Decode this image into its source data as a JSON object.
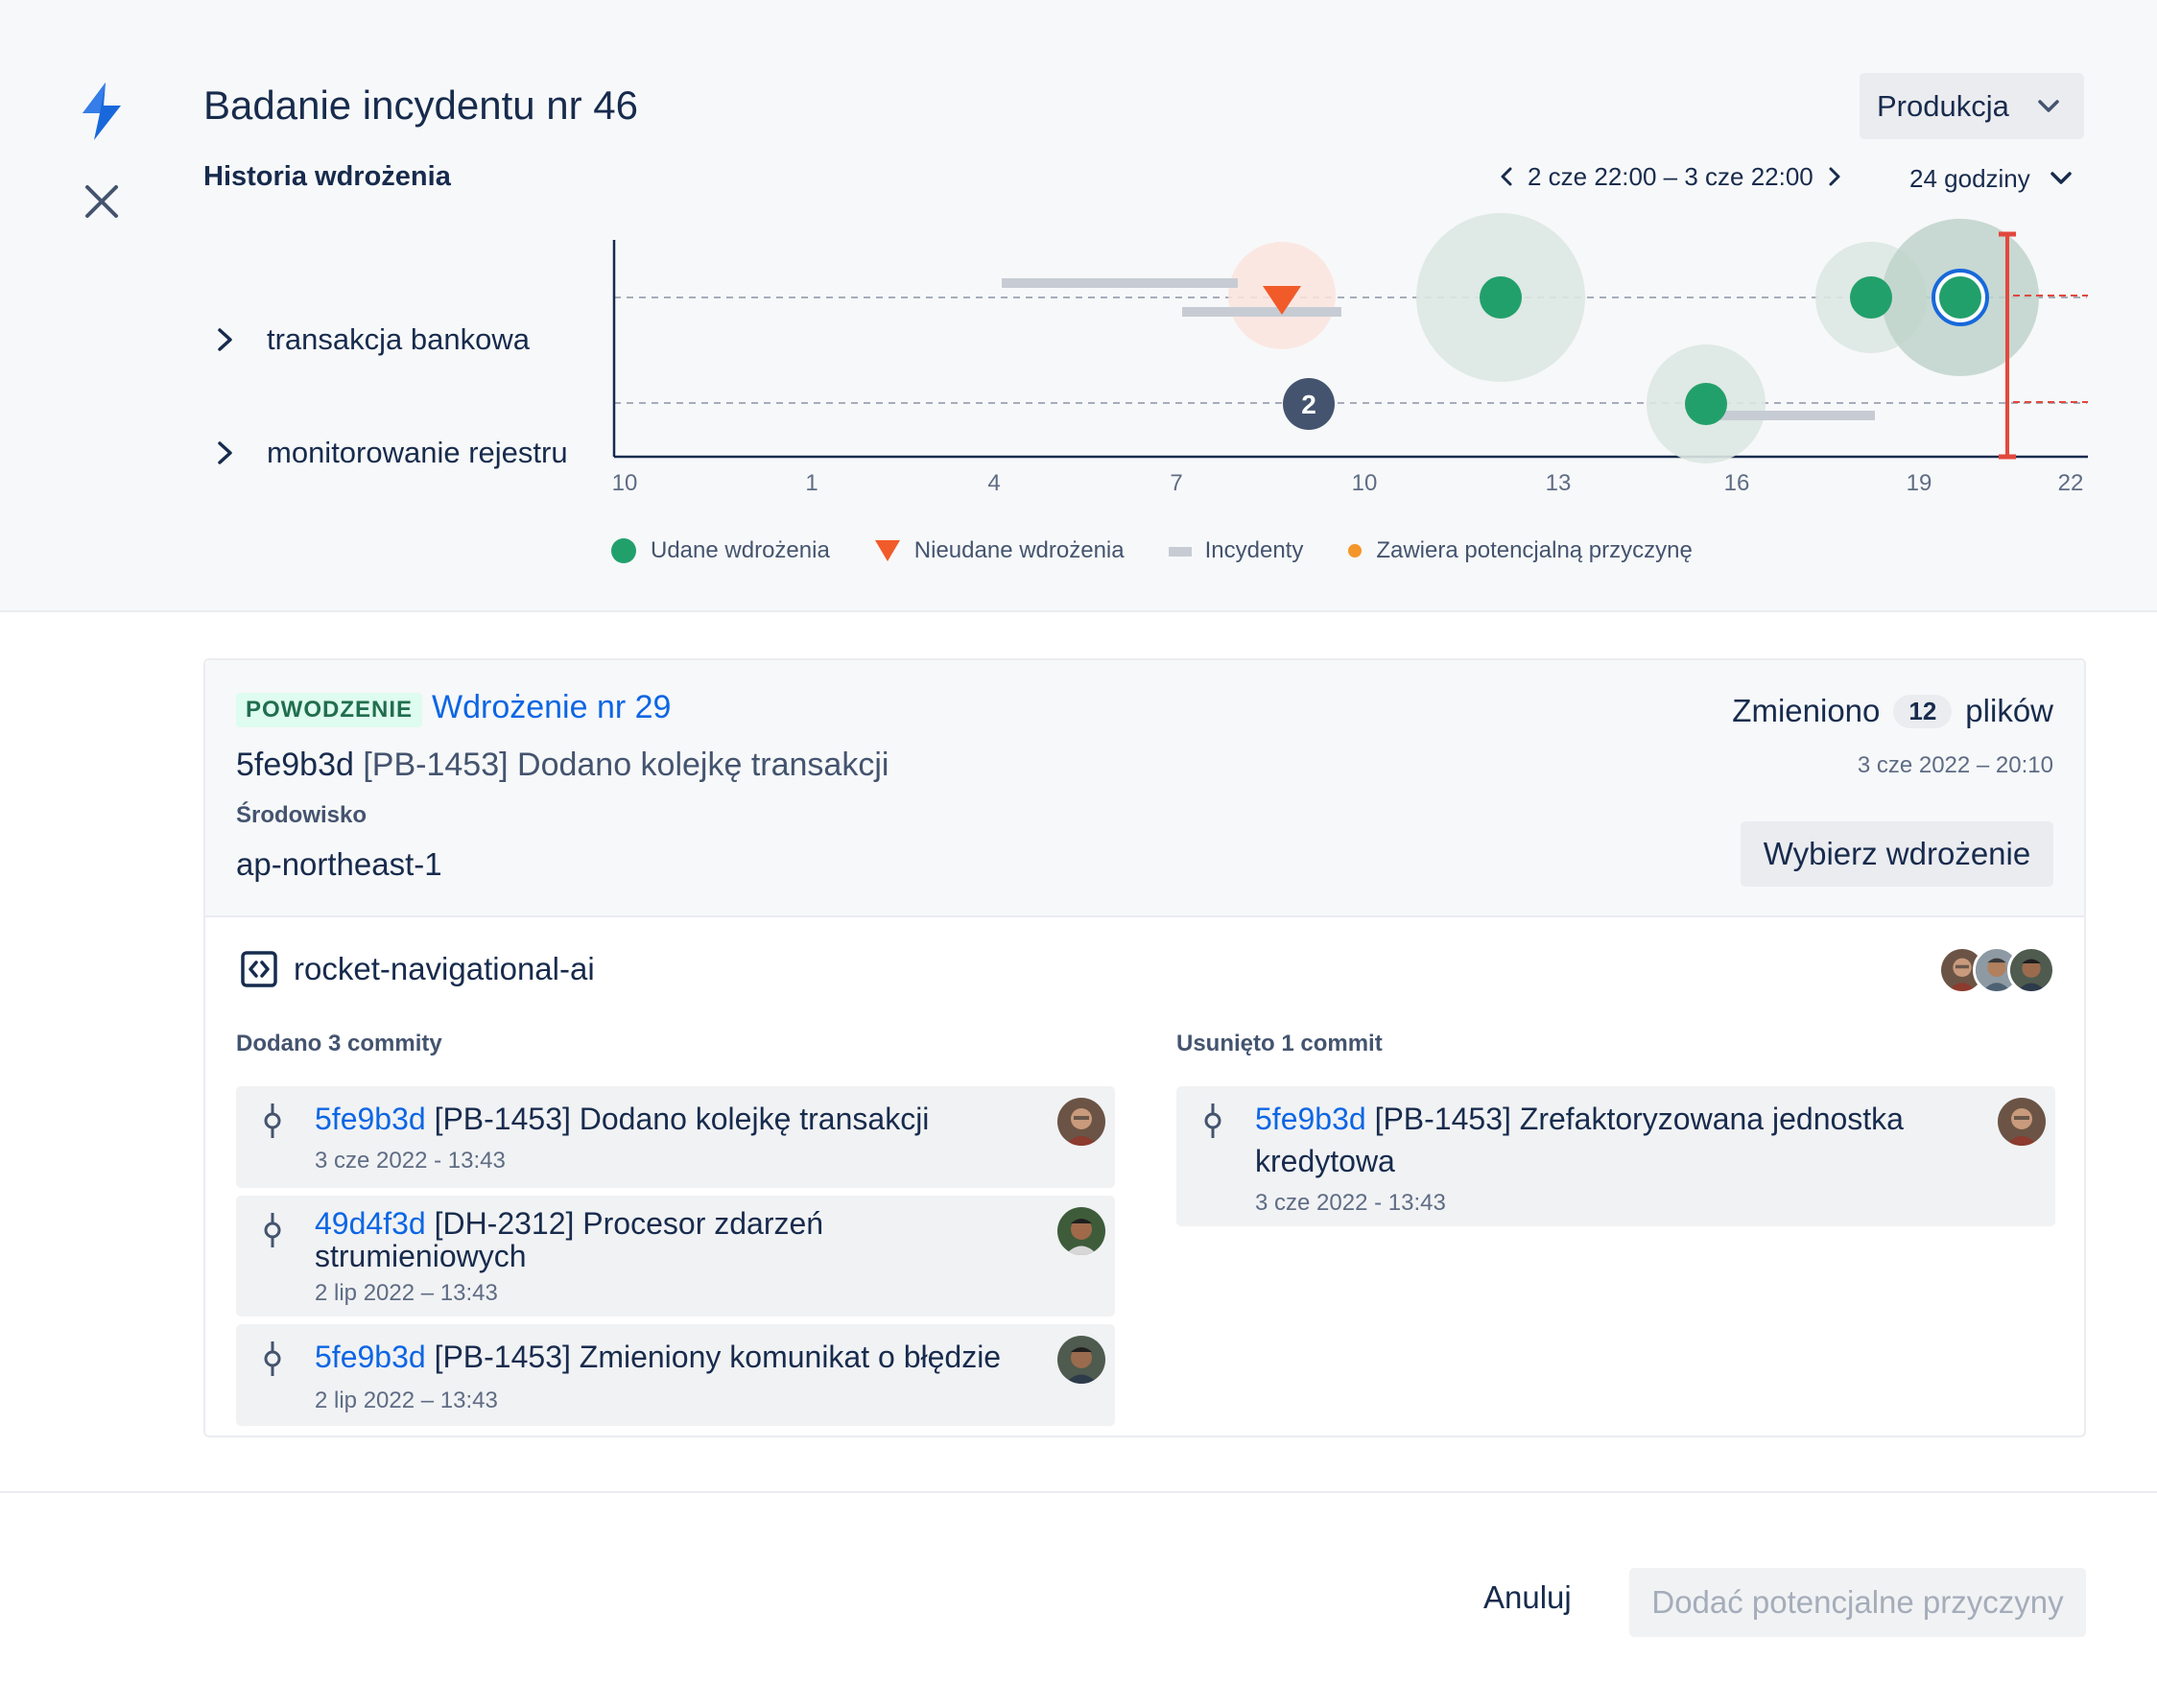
{
  "header": {
    "title": "Badanie incydentu nr 46",
    "subtitle": "Historia wdrożenia",
    "environment_select": "Produkcja",
    "time_range": "2 cze 22:00 – 3 cze 22:00",
    "time_span": "24 godziny"
  },
  "rows": [
    "transakcja bankowa",
    "monitorowanie rejestru"
  ],
  "chart_data": {
    "type": "scatter",
    "x_ticks": [
      "10",
      "1",
      "4",
      "7",
      "10",
      "13",
      "16",
      "19",
      "22"
    ],
    "rows": [
      "transakcja bankowa",
      "monitorowanie rejestru"
    ],
    "legend": [
      {
        "label": "Udane wdrożenia",
        "color": "#22A06B",
        "shape": "circle"
      },
      {
        "label": "Nieudane wdrożenia",
        "color": "#F15B2A",
        "shape": "triangle"
      },
      {
        "label": "Incydenty",
        "color": "#C7CCD4",
        "shape": "bar"
      },
      {
        "label": "Zawiera potencjalną przyczynę",
        "color": "#F5962B",
        "shape": "dot"
      }
    ],
    "group_count_label": "2"
  },
  "deployment": {
    "status": "POWODZENIE",
    "name": "Wdrożenie nr 29",
    "commit_hash": "5fe9b3d",
    "commit_message": "[PB-1453] Dodano kolejkę transakcji",
    "env_label": "Środowisko",
    "env_value": "ap-northeast-1",
    "changed_prefix": "Zmieniono",
    "changed_count": "12",
    "changed_suffix": "plików",
    "date": "3 cze 2022 – 20:10",
    "choose_button": "Wybierz wdrożenie"
  },
  "repo": {
    "name": "rocket-navigational-ai",
    "added_title": "Dodano 3 commity",
    "removed_title": "Usunięto 1 commit",
    "added": [
      {
        "hash": "5fe9b3d",
        "message": "[PB-1453] Dodano kolejkę transakcji",
        "date": "3 cze 2022 - 13:43"
      },
      {
        "hash": "49d4f3d",
        "message": "[DH-2312] Procesor zdarzeń strumieniowych",
        "date": "2 lip 2022 – 13:43"
      },
      {
        "hash": "5fe9b3d",
        "message": "[PB-1453] Zmieniony komunikat o błędzie",
        "date": "2 lip 2022 – 13:43"
      }
    ],
    "removed": [
      {
        "hash": "5fe9b3d",
        "message": "[PB-1453] Zrefaktoryzowana jednostka kredytowa",
        "date": "3 cze 2022 - 13:43"
      }
    ]
  },
  "footer": {
    "cancel": "Anuluj",
    "add": "Dodać potencjalne przyczyny"
  }
}
